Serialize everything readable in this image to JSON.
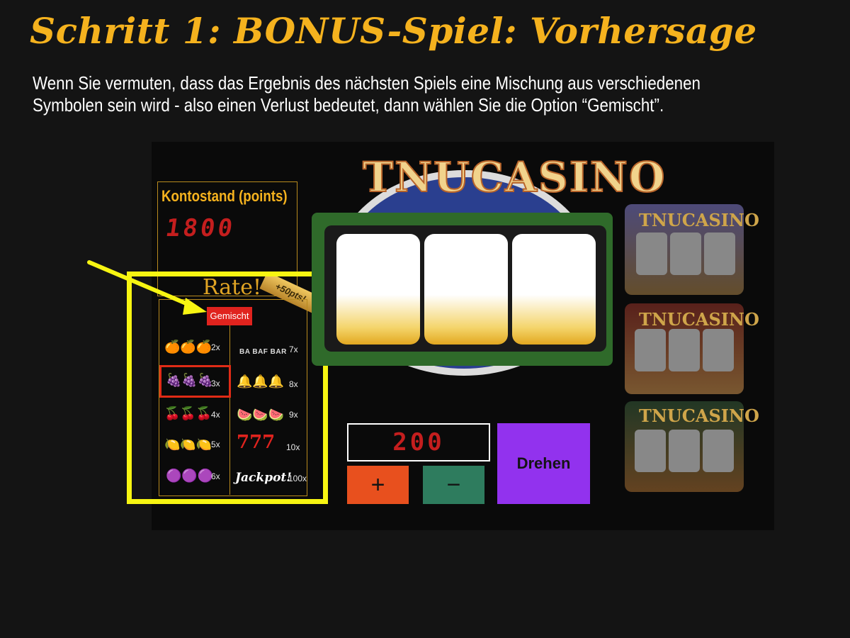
{
  "header": {
    "title": "Schritt 1: BONUS-Spiel: Vorhersage",
    "description": "Wenn Sie vermuten, dass das Ergebnis des nächsten Spiels eine Mischung aus verschiedenen Symbolen sein wird - also einen Verlust bedeutet, dann wählen Sie die Option “Gemischt”."
  },
  "balance": {
    "label": "Kontostand (points)",
    "value": "1800"
  },
  "guess": {
    "title": "Rate!",
    "ribbon": "+50pts!",
    "mixed_button": "Gemischt",
    "selected": "grapes",
    "left_column": [
      {
        "symbol": "orange",
        "icon": "orange-icon",
        "multiplier": "2x"
      },
      {
        "symbol": "grapes",
        "icon": "grapes-icon",
        "multiplier": "3x"
      },
      {
        "symbol": "cherry",
        "icon": "cherry-icon",
        "multiplier": "4x"
      },
      {
        "symbol": "lemon",
        "icon": "lemon-icon",
        "multiplier": "5x"
      },
      {
        "symbol": "plum",
        "icon": "plum-icon",
        "multiplier": "6x"
      }
    ],
    "right_column": [
      {
        "symbol": "bar",
        "icon": "bar-icon",
        "label": "BA BAF BAR",
        "multiplier": "7x"
      },
      {
        "symbol": "bell",
        "icon": "bell-icon",
        "multiplier": "8x"
      },
      {
        "symbol": "watermelon",
        "icon": "watermelon-icon",
        "multiplier": "9x"
      },
      {
        "symbol": "seven",
        "icon": "seven-icon",
        "label": "777",
        "multiplier": "10x"
      },
      {
        "symbol": "jackpot",
        "icon": "jackpot-icon",
        "label": "Jackpot!",
        "multiplier": "100x"
      }
    ]
  },
  "machine": {
    "logo": "TNUCASINO"
  },
  "controls": {
    "bet": "200",
    "plus": "+",
    "minus": "−",
    "spin": "Drehen"
  },
  "thumbnails": [
    {
      "logo": "TNUCASINO"
    },
    {
      "logo": "TNUCASINO"
    },
    {
      "logo": "TNUCASINO"
    }
  ],
  "colors": {
    "title": "#f5b21e",
    "highlight": "#f7f512",
    "mixed": "#e0231e",
    "spin": "#9232ee",
    "plus": "#e8501e",
    "minus": "#2e7c5e"
  }
}
